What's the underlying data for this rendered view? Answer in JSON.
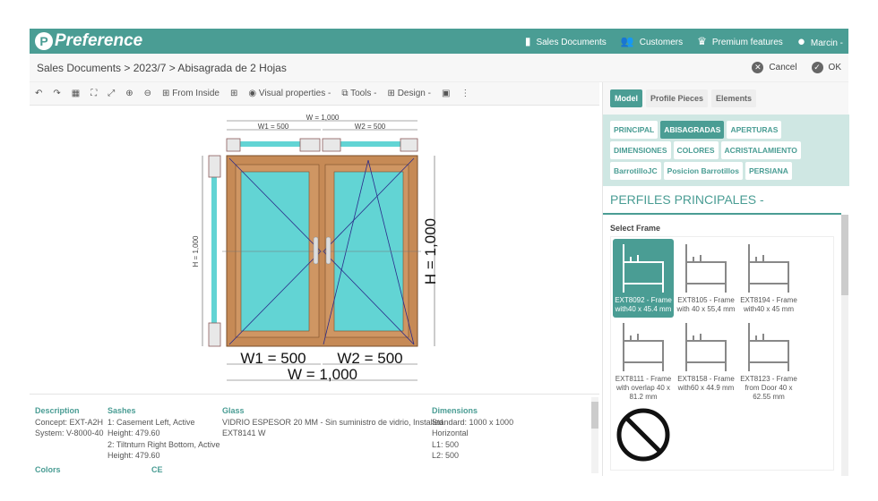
{
  "header": {
    "logo": "Preference",
    "nav": [
      {
        "icon": "document-icon",
        "label": "Sales Documents"
      },
      {
        "icon": "customers-icon",
        "label": "Customers"
      },
      {
        "icon": "crown-icon",
        "label": "Premium features"
      },
      {
        "icon": "user-icon",
        "label": "Marcin -"
      }
    ]
  },
  "breadcrumb": {
    "text": "Sales Documents > 2023/7 > Abisagrada de 2 Hojas",
    "cancel": "Cancel",
    "ok": "OK"
  },
  "toolbar": {
    "from_inside": "From Inside",
    "visual_properties": "Visual properties -",
    "tools": "Tools -",
    "design": "Design -"
  },
  "drawing": {
    "w_total": "W = 1,000",
    "w1": "W1 = 500",
    "w2": "W2 = 500",
    "h": "H = 1,000",
    "w_total_small": "W = 1,000",
    "w1_small": "W1 = 500",
    "w2_small": "W2 = 500",
    "h_small": "H = 1,000",
    "glass_color": "#62d4d4",
    "wood_color": "#c68a56"
  },
  "details": {
    "description": {
      "title": "Description",
      "lines": [
        "Concept:  EXT-A2H",
        "System:  V-8000-40"
      ]
    },
    "sashes": {
      "title": "Sashes",
      "lines": [
        "1: Casement Left, Active",
        "Height: 479.60",
        "2: Tiltnturn Right Bottom, Active",
        "Height: 479.60"
      ]
    },
    "glass": {
      "title": "Glass",
      "lines": [
        "VIDRIO ESPESOR 20 MM - Sin suministro de vidrio, Installed",
        "EXT8141 W"
      ]
    },
    "dimensions": {
      "title": "Dimensions",
      "lines": [
        "Standard: 1000 x 1000",
        "Horizontal",
        "L1: 500",
        "L2: 500"
      ]
    },
    "colors": "Colors",
    "ce": "CE"
  },
  "panel": {
    "tabs": [
      "Model",
      "Profile Pieces",
      "Elements"
    ],
    "groups": [
      "PRINCIPAL",
      "ABISAGRADAS",
      "APERTURAS",
      "DIMENSIONES",
      "COLORES",
      "ACRISTALAMIENTO",
      "BarrotilloJC",
      "Posicion Barrotillos",
      "PERSIANA"
    ],
    "section": "PERFILES PRINCIPALES -",
    "select_label": "Select Frame",
    "frames": [
      "EXT8092 - Frame with40 x 45.4 mm",
      "EXT8105 - Frame with 40 x 55,4 mm",
      "EXT8194 - Frame with40 x 45 mm",
      "EXT8111 - Frame with overlap 40 x 81.2 mm",
      "EXT8158 - Frame with60 x 44.9 mm",
      "EXT8123 - Frame from Door 40 x 62.55 mm"
    ]
  }
}
